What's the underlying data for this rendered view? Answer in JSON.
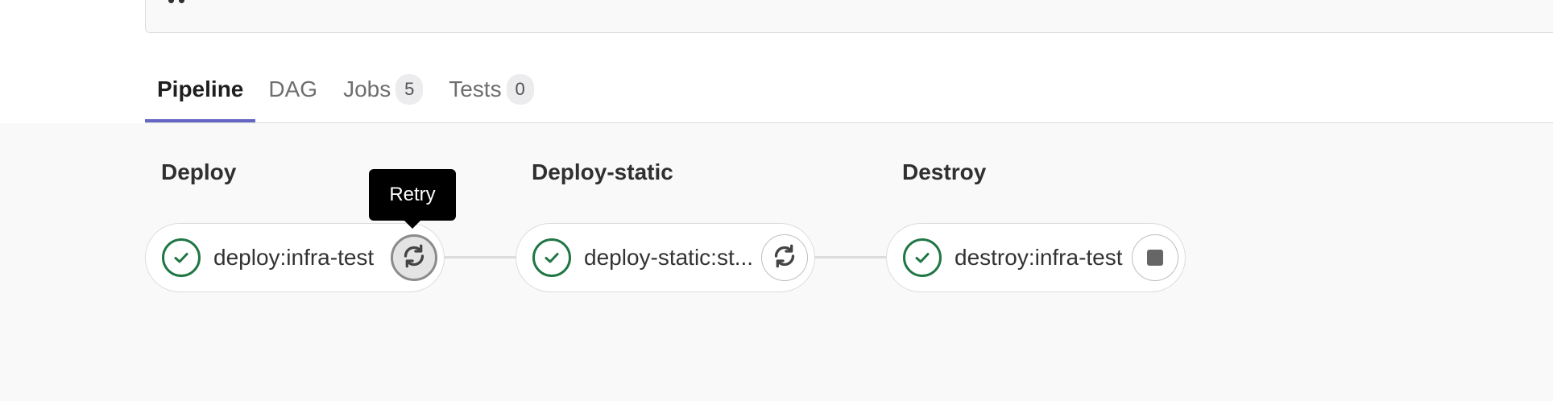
{
  "tabs": [
    {
      "label": "Pipeline",
      "active": true
    },
    {
      "label": "DAG"
    },
    {
      "label": "Jobs",
      "count": "5"
    },
    {
      "label": "Tests",
      "count": "0"
    }
  ],
  "stages": [
    {
      "title": "Deploy",
      "job": {
        "name": "deploy:infra-test",
        "status": "success",
        "action": "retry-icon"
      }
    },
    {
      "title": "Deploy-static",
      "job": {
        "name": "deploy-static:st...",
        "status": "success",
        "action": "retry-icon"
      }
    },
    {
      "title": "Destroy",
      "job": {
        "name": "destroy:infra-test",
        "status": "success",
        "action": "stop-icon"
      }
    }
  ],
  "tooltip": {
    "label": "Retry"
  },
  "colors": {
    "success": "#217645",
    "tab_underline": "#6666c4"
  }
}
